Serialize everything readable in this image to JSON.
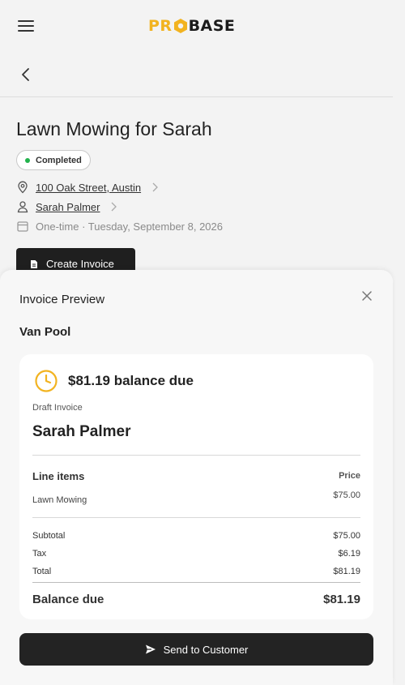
{
  "header": {
    "logo": {
      "left": "PR",
      "right": "BASE",
      "icon": "hexagon-logo-icon"
    },
    "menu_icon": "hamburger-menu-icon",
    "back_icon": "chevron-left-icon"
  },
  "job": {
    "title": "Lawn Mowing for Sarah",
    "status": {
      "label": "Completed",
      "color": "#22b24c"
    },
    "address": "100 Oak Street, Austin",
    "customer": "Sarah Palmer",
    "schedule": "One-time · Tuesday, September 8, 2026",
    "create_invoice_label": "Create Invoice"
  },
  "sheet": {
    "title": "Invoice Preview",
    "company": "Van Pool",
    "invoice": {
      "balance_headline": "$81.19 balance due",
      "draft_label": "Draft Invoice",
      "customer_name": "Sarah Palmer",
      "line_items_label": "Line items",
      "price_label": "Price",
      "items": [
        {
          "name": "Lawn Mowing",
          "price": "$75.00"
        }
      ],
      "subtotal_label": "Subtotal",
      "subtotal": "$75.00",
      "tax_label": "Tax",
      "tax": "$6.19",
      "total_label": "Total",
      "total": "$81.19",
      "balance_due_label": "Balance due",
      "balance_due": "$81.19"
    },
    "send_button_label": "Send to Customer"
  },
  "colors": {
    "brand_yellow": "#f2b320",
    "dark": "#1f1f1f",
    "clock_accent": "#f2b320",
    "status_green": "#22b24c"
  }
}
